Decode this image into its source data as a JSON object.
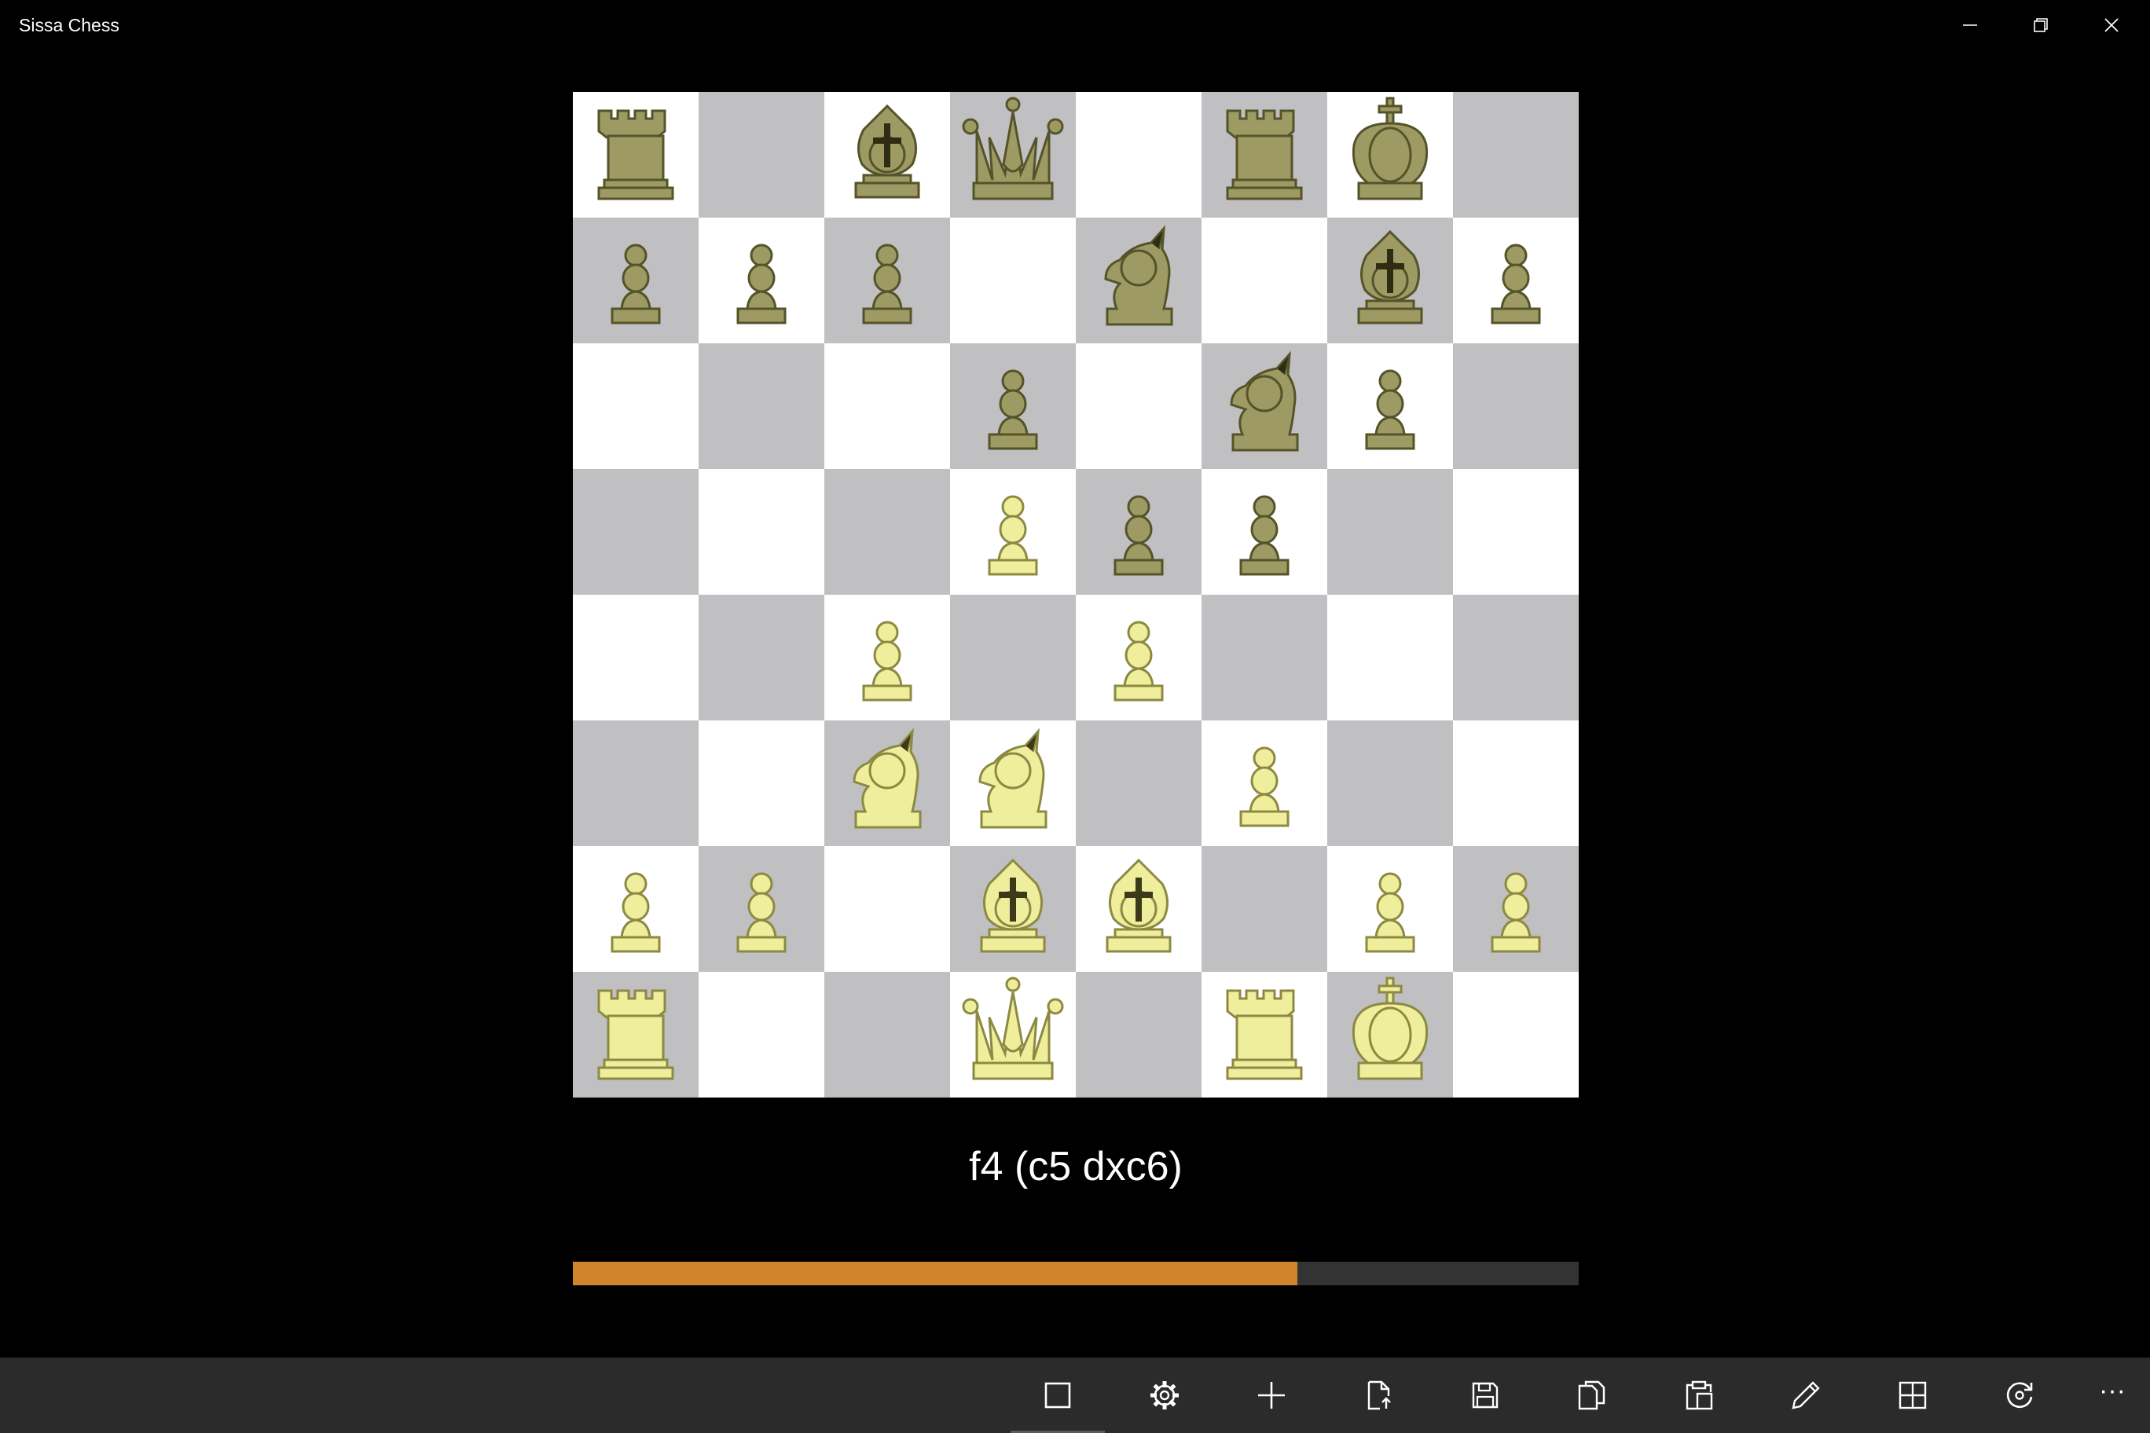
{
  "app": {
    "title": "Sissa Chess"
  },
  "window_controls": [
    "minimize-icon",
    "restore-icon",
    "close-icon"
  ],
  "board": {
    "orientation": "white-bottom",
    "light_color": "#ffffff",
    "dark_color": "#c0bfc1",
    "rows": [
      [
        "bR",
        "",
        "bB",
        "bQ",
        "",
        "bR",
        "bK",
        ""
      ],
      [
        "bP",
        "bP",
        "bP",
        "",
        "bN",
        "",
        "bB",
        "bP"
      ],
      [
        "",
        "",
        "",
        "bP",
        "",
        "bN",
        "bP",
        ""
      ],
      [
        "",
        "",
        "",
        "wP",
        "bP",
        "bP",
        "",
        ""
      ],
      [
        "",
        "",
        "wP",
        "",
        "wP",
        "",
        "",
        ""
      ],
      [
        "",
        "",
        "wN",
        "wN",
        "",
        "wP",
        "",
        ""
      ],
      [
        "wP",
        "wP",
        "",
        "wB",
        "wB",
        "",
        "wP",
        "wP"
      ],
      [
        "wR",
        "",
        "",
        "wQ",
        "",
        "wR",
        "wK",
        ""
      ]
    ]
  },
  "piece_colors": {
    "white": {
      "fill": "#efee9c",
      "stroke": "#8c8a42",
      "mark": "#3c3a18"
    },
    "black": {
      "fill": "#9d9b63",
      "stroke": "#55532a",
      "mark": "#2e2c12"
    }
  },
  "analysis": {
    "move_text": "f4 (c5 dxc6)",
    "progress": 0.72
  },
  "progress_colors": {
    "fill": "#cf842c",
    "track": "#333333"
  },
  "appbar": {
    "buttons": [
      {
        "name": "stop-button",
        "icon": "stop-icon"
      },
      {
        "name": "settings-button",
        "icon": "gear-icon"
      },
      {
        "name": "new-game-button",
        "icon": "plus-icon"
      },
      {
        "name": "open-button",
        "icon": "open-file-icon"
      },
      {
        "name": "save-button",
        "icon": "save-icon"
      },
      {
        "name": "copy-button",
        "icon": "copy-icon"
      },
      {
        "name": "paste-button",
        "icon": "paste-icon"
      },
      {
        "name": "edit-button",
        "icon": "pencil-icon"
      },
      {
        "name": "board-button",
        "icon": "grid-icon"
      },
      {
        "name": "rotate-button",
        "icon": "rotate-icon"
      }
    ],
    "more_label": "···"
  }
}
